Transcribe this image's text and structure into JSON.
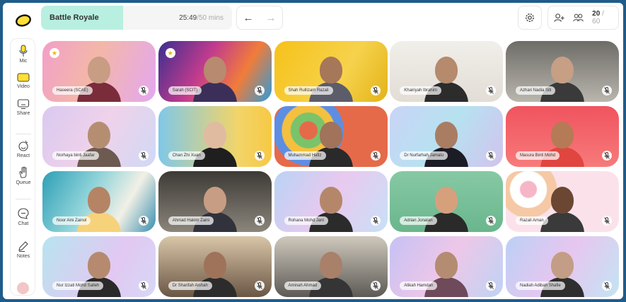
{
  "app": {
    "logo_icon": "logo-icon",
    "accent": "#b8efe0"
  },
  "session": {
    "title": "Battle Royale",
    "elapsed": "25:49",
    "total": "50 mins",
    "progress_fraction": 0.43
  },
  "nav": {
    "back_icon": "arrow-left-icon",
    "forward_icon": "arrow-right-icon"
  },
  "settings": {
    "icon": "gear-icon"
  },
  "participants": {
    "count": "20",
    "max": "/ 60",
    "add_icon": "add-person-icon",
    "group_icon": "group-icon"
  },
  "sidebar": {
    "items": [
      {
        "label": "Mic",
        "icon": "mic-icon"
      },
      {
        "label": "Video",
        "icon": "video-icon"
      },
      {
        "label": "Share",
        "icon": "screen-share-icon"
      },
      {
        "label": "React",
        "icon": "react-icon"
      },
      {
        "label": "Queue",
        "icon": "raise-hand-icon"
      },
      {
        "label": "Chat",
        "icon": "chat-icon"
      },
      {
        "label": "Notes",
        "icon": "pencil-icon"
      }
    ],
    "leave_icon": "leave-icon"
  },
  "tiles": [
    {
      "name": "Haseera (SCAE)",
      "bg": "linear-gradient(110deg,#f2a0c8,#f3b7a8 45%,#e4a7f0)",
      "skin": "#c99c84",
      "wear": "#7a2c3a",
      "star": true
    },
    {
      "name": "Sarah (SCIT)",
      "bg": "linear-gradient(120deg,#3a2f8f,#c23b8e 40%,#f17c3a 70%,#2e9bd8)",
      "skin": "#b88a70",
      "wear": "#3b2f5a",
      "star": true
    },
    {
      "name": "Shah Rullizam Razali",
      "bg": "linear-gradient(120deg,#f6c21a,#f6d24c 60%,#e3b318)",
      "skin": "#a67758",
      "wear": "#5c5c6a",
      "star": false
    },
    {
      "name": "Khairiyah Ibrahim",
      "bg": "linear-gradient(180deg,#f1efea,#e2ddd5)",
      "skin": "#b58a6d",
      "wear": "#2c2c2c",
      "star": false
    },
    {
      "name": "Azhari Nadia Siti",
      "bg": "linear-gradient(180deg,#6e6c68,#b9b6ad)",
      "skin": "#c69f85",
      "wear": "#3a3a3a",
      "star": false
    },
    {
      "name": "Norhaya binti Jaafar",
      "bg": "linear-gradient(120deg,#d9c9f0,#f0d2ea 50%,#cfd9f6)",
      "skin": "#b58e72",
      "wear": "#6d5a50",
      "star": false
    },
    {
      "name": "Chan Zhi Xuan",
      "bg": "linear-gradient(90deg,#7fc8e8,#f2d46a 70%,#f7c944)",
      "skin": "#e1bba0",
      "wear": "#1f1f1f",
      "star": false
    },
    {
      "name": "Muhammad Hafiz",
      "bg": "radial-gradient(circle at 30% 40%,#e56a4a 0 10%,#7ac36b 11% 20%,#f4c040 21% 30%,#5d8ee2 31% 40%,#e56a4a 41%)",
      "skin": "#a0735a",
      "wear": "#2a2a2a",
      "star": false
    },
    {
      "name": "Dr Nurfarhah Jamalu",
      "bg": "linear-gradient(120deg,#c9d4f6,#b6e2f0 50%,#d2c3ee)",
      "skin": "#a97d62",
      "wear": "#1c1c26",
      "star": false
    },
    {
      "name": "Masura Binti Mohd",
      "bg": "linear-gradient(180deg,#f0545e,#f77a7a)",
      "skin": "#b57a56",
      "wear": "#e0463f",
      "star": false
    },
    {
      "name": "Noor Aini Zainol",
      "bg": "linear-gradient(120deg,#2e9fb6,#8fd3d9 40%,#f2f0e6 70%,#3a8fb0)",
      "skin": "#b58465",
      "wear": "#f6d27a",
      "star": false
    },
    {
      "name": "Ahmad Hakim Zaini",
      "bg": "linear-gradient(180deg,#3d3a36,#8b857b)",
      "skin": "#c79e84",
      "wear": "#31323b",
      "star": false
    },
    {
      "name": "Rohana Mohd Jani",
      "bg": "linear-gradient(120deg,#b9d3f5,#e9c9ef 50%,#c8e0f6)",
      "skin": "#b5876a",
      "wear": "#2b2b2b",
      "star": false
    },
    {
      "name": "Adrian Jonatan",
      "bg": "linear-gradient(180deg,#86c9a4,#6ab68d)",
      "skin": "#d7a07d",
      "wear": "#2a2a2a",
      "star": false
    },
    {
      "name": "Razali Aman",
      "bg": "radial-gradient(circle at 20% 30%,#f6b6c8 0 8%,#fff 9% 18%,#f5c9a5 19% 28%,#fbe2ea 29%)",
      "skin": "#6b4633",
      "wear": "#3a3a3a",
      "star": false
    },
    {
      "name": "Nur Izzati Mohd Salleh",
      "bg": "linear-gradient(120deg,#b7e4ef,#e2c8f2 60%,#d6d8f6)",
      "skin": "#b58a6f",
      "wear": "#2a2a2a",
      "star": false
    },
    {
      "name": "Dr Sharifah Aishah",
      "bg": "linear-gradient(180deg,#d9c6a8,#6a5645)",
      "skin": "#9f7359",
      "wear": "#2c2c2c",
      "star": false
    },
    {
      "name": "Aminah Ahmad",
      "bg": "linear-gradient(180deg,#cfc8bd,#5d5a55)",
      "skin": "#a9806a",
      "wear": "#353535",
      "star": false
    },
    {
      "name": "Atikah Hamdan",
      "bg": "linear-gradient(120deg,#c6c1f4,#eec7e8 50%,#bfd3f4)",
      "skin": "#b48c72",
      "wear": "#6e4a5a",
      "star": false
    },
    {
      "name": "Nadiah Adibah Shafie",
      "bg": "linear-gradient(120deg,#bcd0f6,#e7c6ef 50%,#c3e4f3)",
      "skin": "#c39d86",
      "wear": "#2e2e2e",
      "star": false
    }
  ]
}
